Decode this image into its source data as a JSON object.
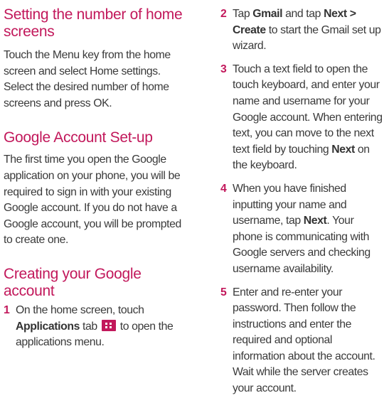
{
  "sec1": {
    "heading": "Setting the number of home screens",
    "body": "Touch the Menu key from the home screen and select Home settings. Select the desired number of home screens and press OK."
  },
  "sec2": {
    "heading": "Google Account Set-up",
    "body": "The first time you open the Google application on your phone, you will be required to sign in with your existing Google account. If you do not have a Google account, you will be prompted to create one."
  },
  "sec3": {
    "heading": "Creating your Google account"
  },
  "steps": [
    {
      "num": "1",
      "a": "On the home screen, touch ",
      "b1": "Applications",
      "c": " tab ",
      "icon": "applications-grid-icon",
      "d": " to open the applications menu."
    },
    {
      "num": "2",
      "a": "Tap ",
      "b1": "Gmail",
      "c": " and tap ",
      "b2": "Next > Create",
      "d": " to start the Gmail set up wizard."
    },
    {
      "num": "3",
      "a": "Touch a text field to open the touch keyboard, and enter your name and username for your Google account. When entering text, you can move to the next text field by touching ",
      "b1": "Next",
      "c": " on the keyboard."
    },
    {
      "num": "4",
      "a": "When you have finished inputting your name and username, tap ",
      "b1": "Next",
      "c": ". Your phone is communicating with Google servers and checking username availability."
    },
    {
      "num": "5",
      "a": "Enter and re-enter your password. Then follow the instructions and enter the required and optional information about the account. Wait while the server creates your account."
    }
  ],
  "colors": {
    "heading": "#c2185b",
    "text": "#3a3a3a",
    "icon_bg": "#c2185b"
  }
}
